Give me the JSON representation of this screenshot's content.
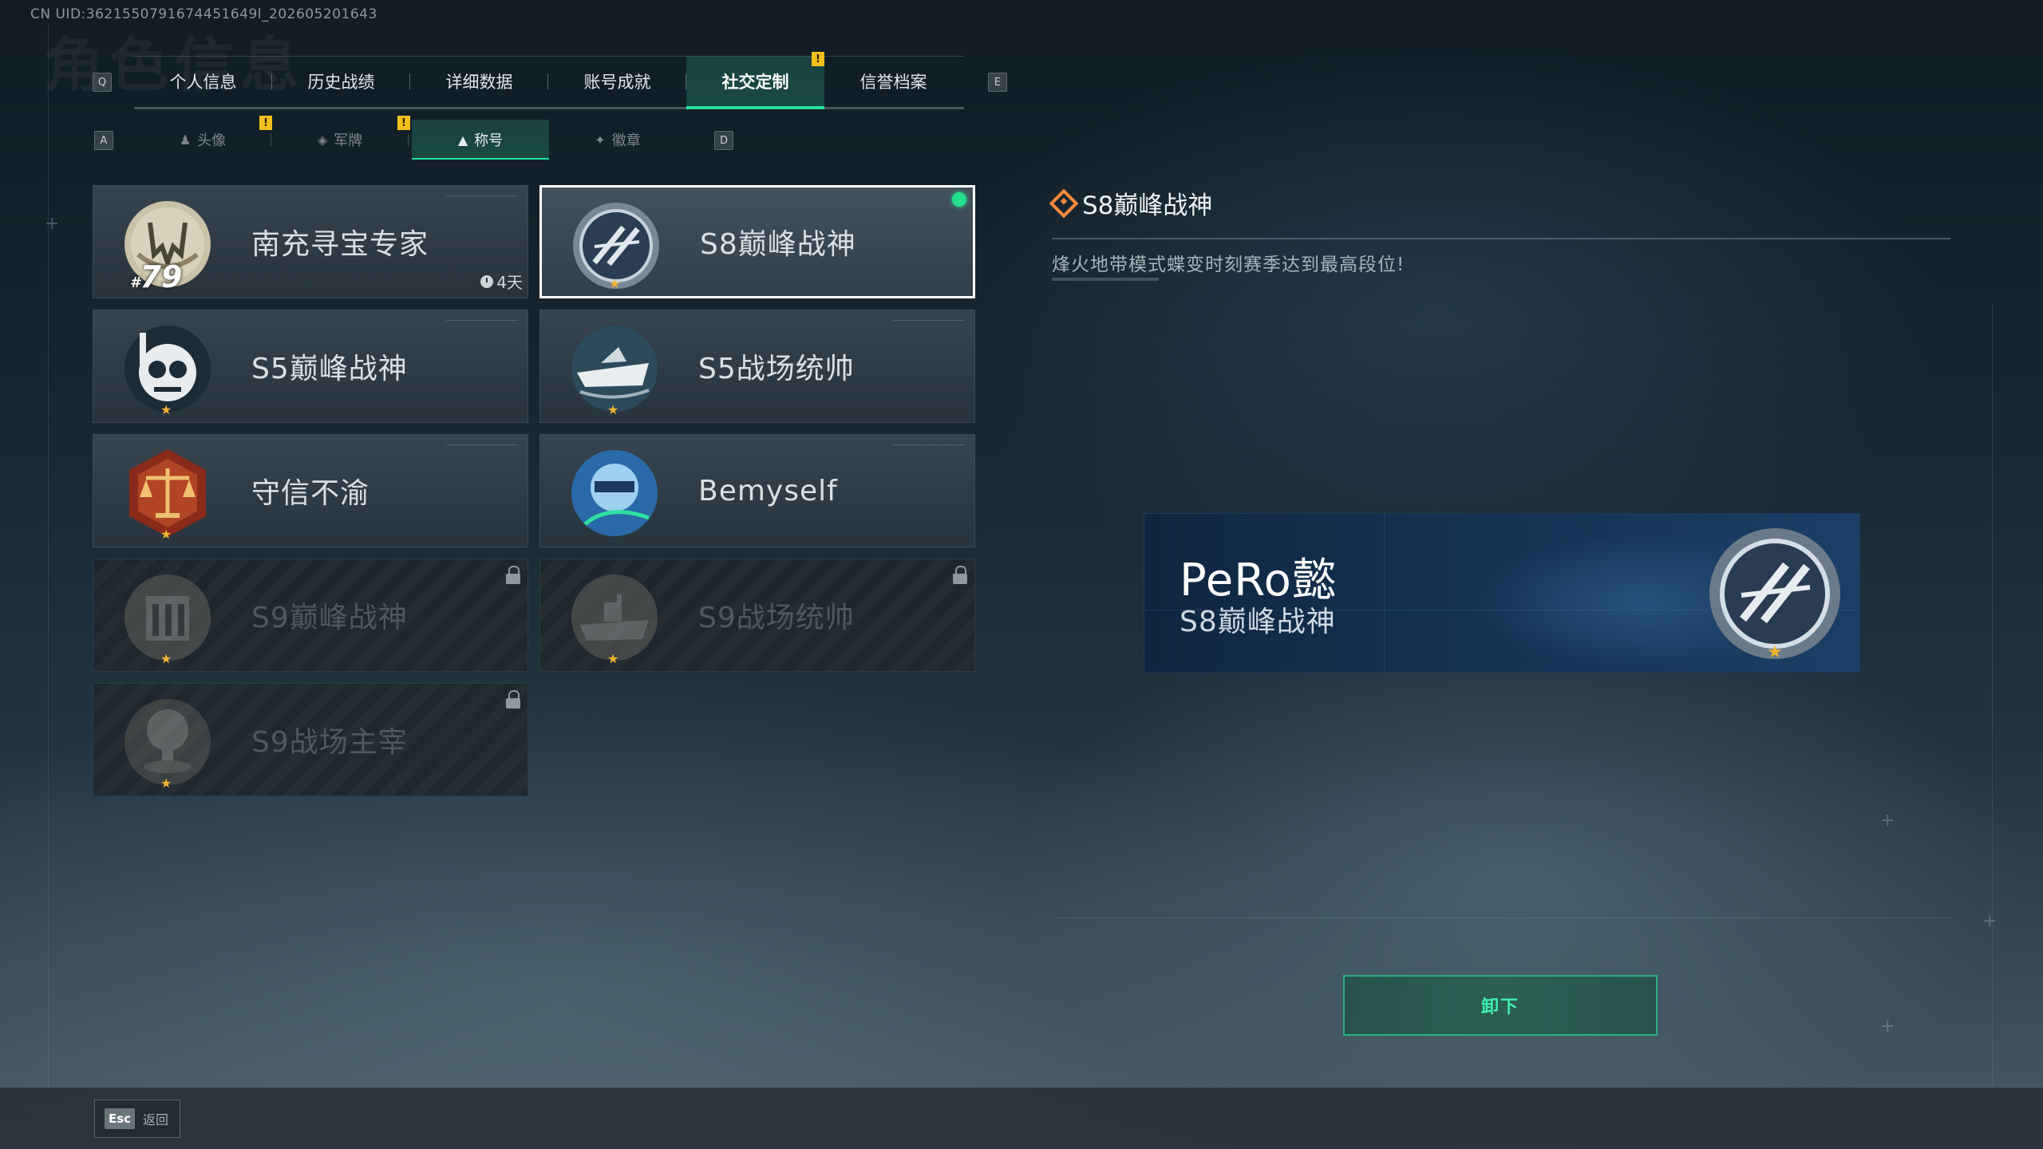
{
  "uid_text": "CN UID:3621550791674451649l_202605201643",
  "background_title": "角色信息",
  "main_tabs": [
    {
      "label": "个人信息",
      "active": false
    },
    {
      "label": "历史战绩",
      "active": false
    },
    {
      "label": "详细数据",
      "active": false
    },
    {
      "label": "账号成就",
      "active": false
    },
    {
      "label": "社交定制",
      "active": true,
      "notification": "!"
    },
    {
      "label": "信誉档案",
      "active": false
    }
  ],
  "main_tab_keys": {
    "prev": "Q",
    "next": "E"
  },
  "sub_tabs": [
    {
      "label": "头像",
      "icon": "person-icon",
      "notification": "!"
    },
    {
      "label": "军牌",
      "icon": "dogtag-icon",
      "notification": "!"
    },
    {
      "label": "称号",
      "icon": "title-icon",
      "active": true
    },
    {
      "label": "徽章",
      "icon": "badge-icon"
    }
  ],
  "sub_tab_keys": {
    "prev": "A",
    "next": "D"
  },
  "titles": [
    {
      "name": "南充寻宝专家",
      "rank_prefix": "#",
      "rank": "79",
      "timer": "4天",
      "locked": false
    },
    {
      "name": "S8巅峰战神",
      "selected": true,
      "equipped": true,
      "locked": false
    },
    {
      "name": "S5巅峰战神",
      "locked": false
    },
    {
      "name": "S5战场统帅",
      "locked": false
    },
    {
      "name": "守信不渝",
      "locked": false
    },
    {
      "name": "Bemyself",
      "locked": false
    },
    {
      "name": "S9巅峰战神",
      "locked": true
    },
    {
      "name": "S9战场统帅",
      "locked": true
    },
    {
      "name": "S9战场主宰",
      "locked": true
    }
  ],
  "detail": {
    "title": "S8巅峰战神",
    "description": "烽火地带模式蝶变时刻赛季达到最高段位!"
  },
  "preview": {
    "player_name": "PeRo懿",
    "title": "S8巅峰战神"
  },
  "actions": {
    "unequip": "卸下"
  },
  "bottom": {
    "esc_key": "Esc",
    "esc_label": "返回"
  },
  "colors": {
    "accent": "#25e0a0",
    "notification": "#f2c01c",
    "equipped": "#24e08e",
    "star": "#f0b630"
  }
}
